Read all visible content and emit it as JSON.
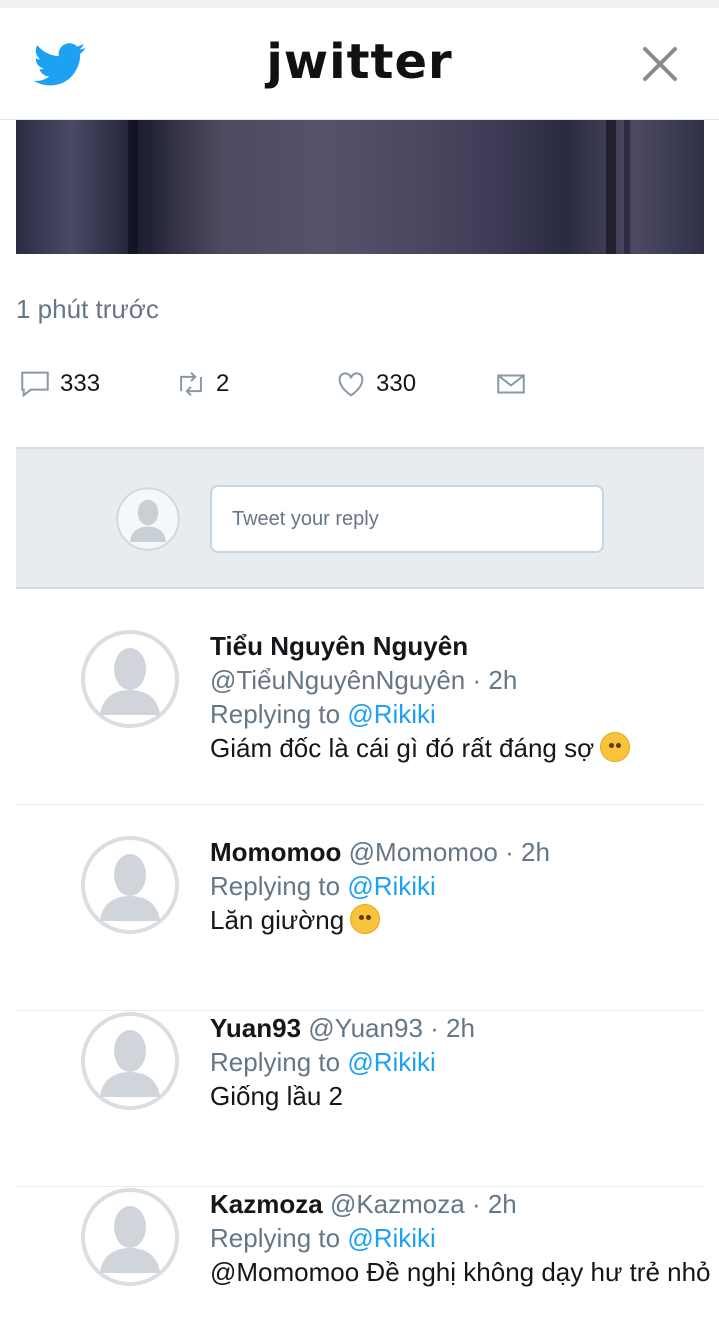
{
  "header": {
    "logo_text": "jwitter",
    "bird_icon": "bird-icon",
    "close_icon": "close-icon"
  },
  "tweet": {
    "timestamp": "1 phút trước",
    "actions": {
      "replies": "333",
      "retweets": "2",
      "likes": "330"
    }
  },
  "reply_box": {
    "placeholder": "Tweet your reply"
  },
  "replies": [
    {
      "name": "Tiểu Nguyên Nguyên",
      "handle": "@TiểuNguyênNguyên",
      "time": "2h",
      "replying_prefix": "Replying to",
      "replying_to": "@Rikiki",
      "text": "Giám đốc là cái gì đó rất đáng sợ",
      "emoji": "persevering-face-emoji"
    },
    {
      "name": "Momomoo",
      "handle": "@Momomoo",
      "time": "2h",
      "replying_prefix": "Replying to",
      "replying_to": "@Rikiki",
      "text": "Lăn giường",
      "emoji": "no-mouth-face-emoji"
    },
    {
      "name": "Yuan93",
      "handle": "@Yuan93",
      "time": "2h",
      "replying_prefix": "Replying to",
      "replying_to": "@Rikiki",
      "text": "Giống lầu 2"
    },
    {
      "name": "Kazmoza",
      "handle": "@Kazmoza",
      "time": "2h",
      "replying_prefix": "Replying to",
      "replying_to": "@Rikiki",
      "text": "@Momomoo Đề nghị không dạy hư trẻ nhỏ"
    }
  ],
  "colors": {
    "brand": "#1da1f2",
    "muted": "#657786",
    "reply_bg": "#e6ecf0"
  }
}
